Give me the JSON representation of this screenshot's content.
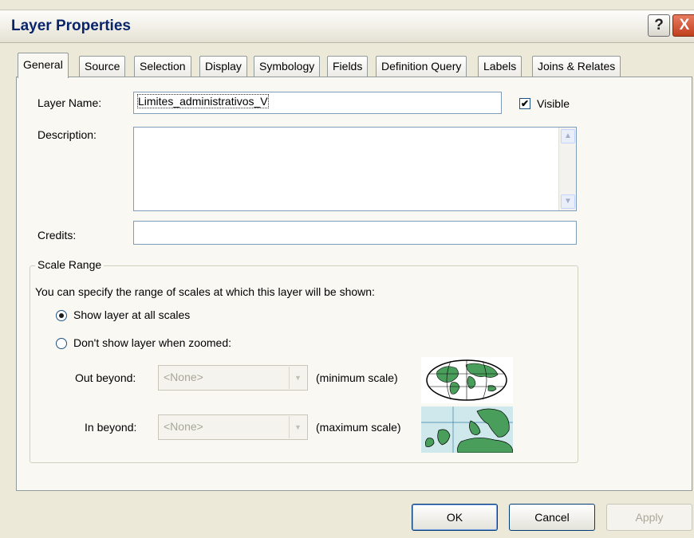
{
  "window": {
    "title": "Layer Properties"
  },
  "titlebar_buttons": {
    "help": "?",
    "close": "X"
  },
  "tabs": [
    "General",
    "Source",
    "Selection",
    "Display",
    "Symbology",
    "Fields",
    "Definition Query",
    "Labels",
    "Joins & Relates"
  ],
  "general": {
    "layer_name_label": "Layer Name:",
    "layer_name_value": "Limites_administrativos_V",
    "visible_label": "Visible",
    "visible_checked": true,
    "description_label": "Description:",
    "description_value": "",
    "credits_label": "Credits:",
    "credits_value": ""
  },
  "scale_range": {
    "title": "Scale Range",
    "instruction": "You can specify the range of scales at which this layer will be shown:",
    "option_all": "Show layer at all scales",
    "option_zoomed": "Don't show layer when zoomed:",
    "selected_option": "all",
    "out_beyond_label": "Out beyond:",
    "out_beyond_value": "<None>",
    "min_scale_label": "(minimum scale)",
    "in_beyond_label": "In beyond:",
    "in_beyond_value": "<None>",
    "max_scale_label": "(maximum scale)",
    "icons": [
      "world-globe-icon",
      "europe-map-icon"
    ]
  },
  "buttons": {
    "ok": "OK",
    "cancel": "Cancel",
    "apply": "Apply"
  },
  "colors": {
    "title_text": "#0a246a",
    "map_land": "#4a9e5c",
    "map_water": "#cfe8ec"
  }
}
